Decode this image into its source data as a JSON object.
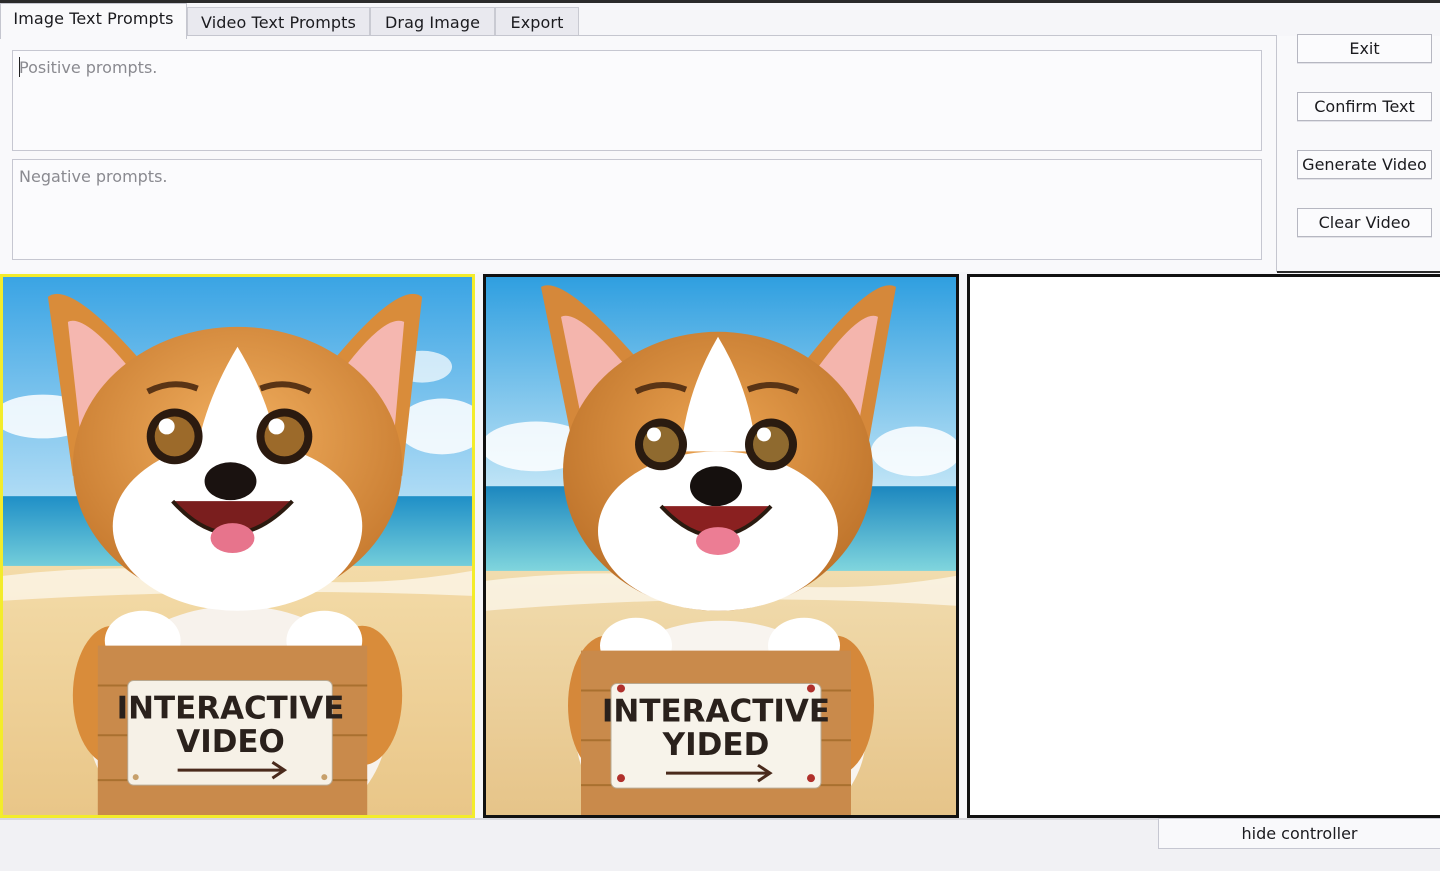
{
  "tabs": [
    {
      "label": "Image Text Prompts",
      "active": true
    },
    {
      "label": "Video Text Prompts",
      "active": false
    },
    {
      "label": "Drag Image",
      "active": false
    },
    {
      "label": "Export",
      "active": false
    }
  ],
  "prompts": {
    "positive_placeholder": "Positive prompts.",
    "negative_placeholder": "Negative prompts."
  },
  "controls": {
    "exit": "Exit",
    "confirm_text": "Confirm Text",
    "generate_video": "Generate Video",
    "clear_video": "Clear Video"
  },
  "images": [
    {
      "sign_line1": "INTERACTIVE",
      "sign_line2": "VIDEO",
      "selected": true,
      "highlight_color": "#f3ec2b"
    },
    {
      "sign_line1": "INTERACTIVE",
      "sign_line2": "YIDED",
      "selected": false
    }
  ],
  "footer": {
    "hide_controller": "hide controller"
  }
}
